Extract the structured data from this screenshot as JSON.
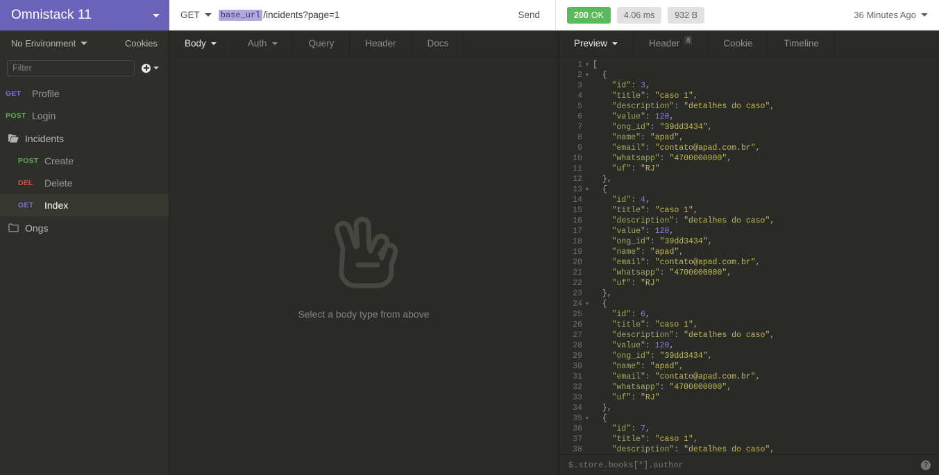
{
  "workspace": {
    "title": "Omnistack 11",
    "accent_color": "#6b62ba"
  },
  "request_bar": {
    "method": "GET",
    "url_variable": "base_url",
    "url_path": "/incidents?page=1",
    "send_label": "Send"
  },
  "response_status": {
    "code": "200",
    "code_text": "OK",
    "time": "4.06 ms",
    "size": "932 B",
    "status_color": "#5cb85c",
    "history_label": "36 Minutes Ago"
  },
  "sidebar": {
    "environment_label": "No Environment",
    "cookies_label": "Cookies",
    "filter_placeholder": "Filter",
    "items": [
      {
        "type": "request",
        "method": "GET",
        "method_class": "m-get",
        "name": "Profile",
        "nested": false,
        "active": false
      },
      {
        "type": "request",
        "method": "POST",
        "method_class": "m-post",
        "name": "Login",
        "nested": false,
        "active": false
      },
      {
        "type": "folder",
        "name": "Incidents",
        "open": true
      },
      {
        "type": "request",
        "method": "POST",
        "method_class": "m-post",
        "name": "Create",
        "nested": true,
        "active": false
      },
      {
        "type": "request",
        "method": "DEL",
        "method_class": "m-del",
        "name": "Delete",
        "nested": true,
        "active": false
      },
      {
        "type": "request",
        "method": "GET",
        "method_class": "m-get",
        "name": "Index",
        "nested": true,
        "active": true
      },
      {
        "type": "folder",
        "name": "Ongs",
        "open": false
      }
    ]
  },
  "request_tabs": [
    {
      "label": "Body",
      "active": true,
      "has_caret": true,
      "badge": null
    },
    {
      "label": "Auth",
      "active": false,
      "has_caret": true,
      "badge": null
    },
    {
      "label": "Query",
      "active": false,
      "has_caret": false,
      "badge": null
    },
    {
      "label": "Header",
      "active": false,
      "has_caret": false,
      "badge": null
    },
    {
      "label": "Docs",
      "active": false,
      "has_caret": false,
      "badge": null
    }
  ],
  "request_empty_state": {
    "icon": "peace-hand-icon",
    "text": "Select a body type from above"
  },
  "response_tabs": [
    {
      "label": "Preview",
      "active": true,
      "has_caret": true,
      "badge": null
    },
    {
      "label": "Header",
      "active": false,
      "has_caret": false,
      "badge": "8"
    },
    {
      "label": "Cookie",
      "active": false,
      "has_caret": false,
      "badge": null
    },
    {
      "label": "Timeline",
      "active": false,
      "has_caret": false,
      "badge": null
    }
  ],
  "response_filter": {
    "placeholder": "$.store.books[*].author"
  },
  "response_body": {
    "lines": [
      {
        "n": 1,
        "fold": true,
        "tokens": [
          {
            "t": "punc",
            "v": "["
          }
        ],
        "indent": 0
      },
      {
        "n": 2,
        "fold": true,
        "tokens": [
          {
            "t": "punc",
            "v": "{"
          }
        ],
        "indent": 1
      },
      {
        "n": 3,
        "fold": false,
        "tokens": [
          {
            "t": "key",
            "v": "\"id\""
          },
          {
            "t": "punc",
            "v": ": "
          },
          {
            "t": "num",
            "v": "3"
          },
          {
            "t": "punc",
            "v": ","
          }
        ],
        "indent": 2
      },
      {
        "n": 4,
        "fold": false,
        "tokens": [
          {
            "t": "key",
            "v": "\"title\""
          },
          {
            "t": "punc",
            "v": ": "
          },
          {
            "t": "str",
            "v": "\"caso 1\""
          },
          {
            "t": "punc",
            "v": ","
          }
        ],
        "indent": 2
      },
      {
        "n": 5,
        "fold": false,
        "tokens": [
          {
            "t": "key",
            "v": "\"description\""
          },
          {
            "t": "punc",
            "v": ": "
          },
          {
            "t": "str",
            "v": "\"detalhes do caso\""
          },
          {
            "t": "punc",
            "v": ","
          }
        ],
        "indent": 2
      },
      {
        "n": 6,
        "fold": false,
        "tokens": [
          {
            "t": "key",
            "v": "\"value\""
          },
          {
            "t": "punc",
            "v": ": "
          },
          {
            "t": "num",
            "v": "120"
          },
          {
            "t": "punc",
            "v": ","
          }
        ],
        "indent": 2
      },
      {
        "n": 7,
        "fold": false,
        "tokens": [
          {
            "t": "key",
            "v": "\"ong_id\""
          },
          {
            "t": "punc",
            "v": ": "
          },
          {
            "t": "str",
            "v": "\"39dd3434\""
          },
          {
            "t": "punc",
            "v": ","
          }
        ],
        "indent": 2
      },
      {
        "n": 8,
        "fold": false,
        "tokens": [
          {
            "t": "key",
            "v": "\"name\""
          },
          {
            "t": "punc",
            "v": ": "
          },
          {
            "t": "str",
            "v": "\"apad\""
          },
          {
            "t": "punc",
            "v": ","
          }
        ],
        "indent": 2
      },
      {
        "n": 9,
        "fold": false,
        "tokens": [
          {
            "t": "key",
            "v": "\"email\""
          },
          {
            "t": "punc",
            "v": ": "
          },
          {
            "t": "str",
            "v": "\"contato@apad.com.br\""
          },
          {
            "t": "punc",
            "v": ","
          }
        ],
        "indent": 2
      },
      {
        "n": 10,
        "fold": false,
        "tokens": [
          {
            "t": "key",
            "v": "\"whatsapp\""
          },
          {
            "t": "punc",
            "v": ": "
          },
          {
            "t": "str",
            "v": "\"4700000000\""
          },
          {
            "t": "punc",
            "v": ","
          }
        ],
        "indent": 2
      },
      {
        "n": 11,
        "fold": false,
        "tokens": [
          {
            "t": "key",
            "v": "\"uf\""
          },
          {
            "t": "punc",
            "v": ": "
          },
          {
            "t": "str",
            "v": "\"RJ\""
          }
        ],
        "indent": 2
      },
      {
        "n": 12,
        "fold": false,
        "tokens": [
          {
            "t": "punc",
            "v": "},"
          }
        ],
        "indent": 1
      },
      {
        "n": 13,
        "fold": true,
        "tokens": [
          {
            "t": "punc",
            "v": "{"
          }
        ],
        "indent": 1
      },
      {
        "n": 14,
        "fold": false,
        "tokens": [
          {
            "t": "key",
            "v": "\"id\""
          },
          {
            "t": "punc",
            "v": ": "
          },
          {
            "t": "num",
            "v": "4"
          },
          {
            "t": "punc",
            "v": ","
          }
        ],
        "indent": 2
      },
      {
        "n": 15,
        "fold": false,
        "tokens": [
          {
            "t": "key",
            "v": "\"title\""
          },
          {
            "t": "punc",
            "v": ": "
          },
          {
            "t": "str",
            "v": "\"caso 1\""
          },
          {
            "t": "punc",
            "v": ","
          }
        ],
        "indent": 2
      },
      {
        "n": 16,
        "fold": false,
        "tokens": [
          {
            "t": "key",
            "v": "\"description\""
          },
          {
            "t": "punc",
            "v": ": "
          },
          {
            "t": "str",
            "v": "\"detalhes do caso\""
          },
          {
            "t": "punc",
            "v": ","
          }
        ],
        "indent": 2
      },
      {
        "n": 17,
        "fold": false,
        "tokens": [
          {
            "t": "key",
            "v": "\"value\""
          },
          {
            "t": "punc",
            "v": ": "
          },
          {
            "t": "num",
            "v": "120"
          },
          {
            "t": "punc",
            "v": ","
          }
        ],
        "indent": 2
      },
      {
        "n": 18,
        "fold": false,
        "tokens": [
          {
            "t": "key",
            "v": "\"ong_id\""
          },
          {
            "t": "punc",
            "v": ": "
          },
          {
            "t": "str",
            "v": "\"39dd3434\""
          },
          {
            "t": "punc",
            "v": ","
          }
        ],
        "indent": 2
      },
      {
        "n": 19,
        "fold": false,
        "tokens": [
          {
            "t": "key",
            "v": "\"name\""
          },
          {
            "t": "punc",
            "v": ": "
          },
          {
            "t": "str",
            "v": "\"apad\""
          },
          {
            "t": "punc",
            "v": ","
          }
        ],
        "indent": 2
      },
      {
        "n": 20,
        "fold": false,
        "tokens": [
          {
            "t": "key",
            "v": "\"email\""
          },
          {
            "t": "punc",
            "v": ": "
          },
          {
            "t": "str",
            "v": "\"contato@apad.com.br\""
          },
          {
            "t": "punc",
            "v": ","
          }
        ],
        "indent": 2
      },
      {
        "n": 21,
        "fold": false,
        "tokens": [
          {
            "t": "key",
            "v": "\"whatsapp\""
          },
          {
            "t": "punc",
            "v": ": "
          },
          {
            "t": "str",
            "v": "\"4700000000\""
          },
          {
            "t": "punc",
            "v": ","
          }
        ],
        "indent": 2
      },
      {
        "n": 22,
        "fold": false,
        "tokens": [
          {
            "t": "key",
            "v": "\"uf\""
          },
          {
            "t": "punc",
            "v": ": "
          },
          {
            "t": "str",
            "v": "\"RJ\""
          }
        ],
        "indent": 2
      },
      {
        "n": 23,
        "fold": false,
        "tokens": [
          {
            "t": "punc",
            "v": "},"
          }
        ],
        "indent": 1
      },
      {
        "n": 24,
        "fold": true,
        "tokens": [
          {
            "t": "punc",
            "v": "{"
          }
        ],
        "indent": 1
      },
      {
        "n": 25,
        "fold": false,
        "tokens": [
          {
            "t": "key",
            "v": "\"id\""
          },
          {
            "t": "punc",
            "v": ": "
          },
          {
            "t": "num",
            "v": "6"
          },
          {
            "t": "punc",
            "v": ","
          }
        ],
        "indent": 2
      },
      {
        "n": 26,
        "fold": false,
        "tokens": [
          {
            "t": "key",
            "v": "\"title\""
          },
          {
            "t": "punc",
            "v": ": "
          },
          {
            "t": "str",
            "v": "\"caso 1\""
          },
          {
            "t": "punc",
            "v": ","
          }
        ],
        "indent": 2
      },
      {
        "n": 27,
        "fold": false,
        "tokens": [
          {
            "t": "key",
            "v": "\"description\""
          },
          {
            "t": "punc",
            "v": ": "
          },
          {
            "t": "str",
            "v": "\"detalhes do caso\""
          },
          {
            "t": "punc",
            "v": ","
          }
        ],
        "indent": 2
      },
      {
        "n": 28,
        "fold": false,
        "tokens": [
          {
            "t": "key",
            "v": "\"value\""
          },
          {
            "t": "punc",
            "v": ": "
          },
          {
            "t": "num",
            "v": "120"
          },
          {
            "t": "punc",
            "v": ","
          }
        ],
        "indent": 2
      },
      {
        "n": 29,
        "fold": false,
        "tokens": [
          {
            "t": "key",
            "v": "\"ong_id\""
          },
          {
            "t": "punc",
            "v": ": "
          },
          {
            "t": "str",
            "v": "\"39dd3434\""
          },
          {
            "t": "punc",
            "v": ","
          }
        ],
        "indent": 2
      },
      {
        "n": 30,
        "fold": false,
        "tokens": [
          {
            "t": "key",
            "v": "\"name\""
          },
          {
            "t": "punc",
            "v": ": "
          },
          {
            "t": "str",
            "v": "\"apad\""
          },
          {
            "t": "punc",
            "v": ","
          }
        ],
        "indent": 2
      },
      {
        "n": 31,
        "fold": false,
        "tokens": [
          {
            "t": "key",
            "v": "\"email\""
          },
          {
            "t": "punc",
            "v": ": "
          },
          {
            "t": "str",
            "v": "\"contato@apad.com.br\""
          },
          {
            "t": "punc",
            "v": ","
          }
        ],
        "indent": 2
      },
      {
        "n": 32,
        "fold": false,
        "tokens": [
          {
            "t": "key",
            "v": "\"whatsapp\""
          },
          {
            "t": "punc",
            "v": ": "
          },
          {
            "t": "str",
            "v": "\"4700000000\""
          },
          {
            "t": "punc",
            "v": ","
          }
        ],
        "indent": 2
      },
      {
        "n": 33,
        "fold": false,
        "tokens": [
          {
            "t": "key",
            "v": "\"uf\""
          },
          {
            "t": "punc",
            "v": ": "
          },
          {
            "t": "str",
            "v": "\"RJ\""
          }
        ],
        "indent": 2
      },
      {
        "n": 34,
        "fold": false,
        "tokens": [
          {
            "t": "punc",
            "v": "},"
          }
        ],
        "indent": 1
      },
      {
        "n": 35,
        "fold": true,
        "tokens": [
          {
            "t": "punc",
            "v": "{"
          }
        ],
        "indent": 1
      },
      {
        "n": 36,
        "fold": false,
        "tokens": [
          {
            "t": "key",
            "v": "\"id\""
          },
          {
            "t": "punc",
            "v": ": "
          },
          {
            "t": "num",
            "v": "7"
          },
          {
            "t": "punc",
            "v": ","
          }
        ],
        "indent": 2
      },
      {
        "n": 37,
        "fold": false,
        "tokens": [
          {
            "t": "key",
            "v": "\"title\""
          },
          {
            "t": "punc",
            "v": ": "
          },
          {
            "t": "str",
            "v": "\"caso 1\""
          },
          {
            "t": "punc",
            "v": ","
          }
        ],
        "indent": 2
      },
      {
        "n": 38,
        "fold": false,
        "tokens": [
          {
            "t": "key",
            "v": "\"description\""
          },
          {
            "t": "punc",
            "v": ": "
          },
          {
            "t": "str",
            "v": "\"detalhes do caso\""
          },
          {
            "t": "punc",
            "v": ","
          }
        ],
        "indent": 2
      }
    ]
  }
}
